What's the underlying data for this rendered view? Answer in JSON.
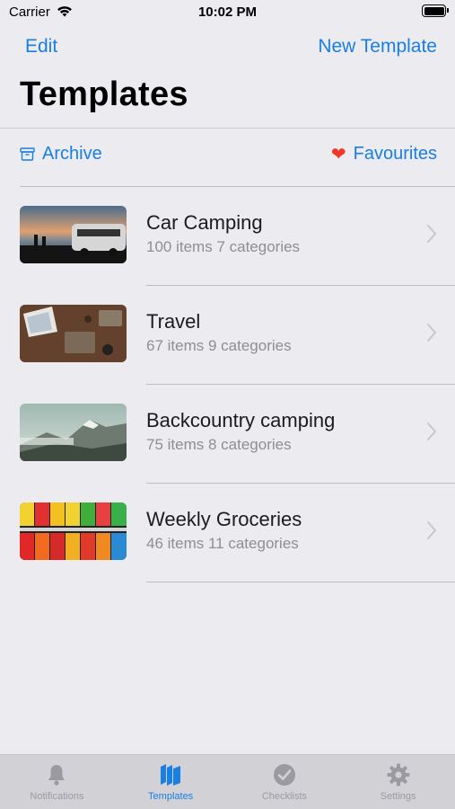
{
  "status_bar": {
    "carrier": "Carrier",
    "time": "10:02 PM"
  },
  "nav": {
    "edit_label": "Edit",
    "new_label": "New Template"
  },
  "page": {
    "title": "Templates"
  },
  "filters": {
    "archive_label": "Archive",
    "favourites_label": "Favourites",
    "heart_color": "#f2362a"
  },
  "templates": [
    {
      "title": "Car Camping",
      "items": "100 items",
      "categories": "7 categories"
    },
    {
      "title": "Travel",
      "items": "67 items",
      "categories": "9 categories"
    },
    {
      "title": "Backcountry camping",
      "items": "75 items",
      "categories": "8 categories"
    },
    {
      "title": "Weekly Groceries",
      "items": "46 items",
      "categories": "11 categories"
    }
  ],
  "tabs": [
    {
      "label": "Notifications",
      "icon": "bell-icon",
      "active": false
    },
    {
      "label": "Templates",
      "icon": "stack-icon",
      "active": true
    },
    {
      "label": "Checklists",
      "icon": "checkmark-circle-icon",
      "active": false
    },
    {
      "label": "Settings",
      "icon": "gear-icon",
      "active": false
    }
  ],
  "colors": {
    "accent": "#1a7fe3",
    "background": "#ebebf0",
    "tabbar": "#d1d1d6",
    "inactive": "#9a9aa0"
  }
}
